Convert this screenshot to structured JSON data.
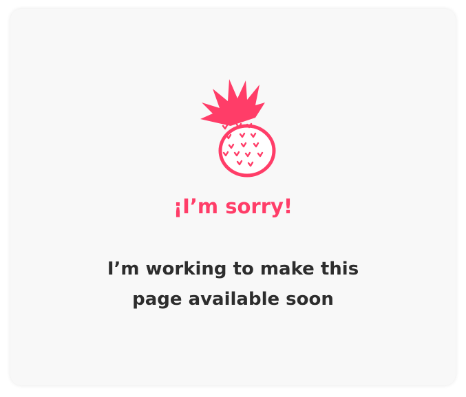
{
  "colors": {
    "accent": "#ff3d68",
    "text": "#2d2d2d",
    "card_background": "#f8f8f8"
  },
  "illustration": {
    "icon": "pineapple-icon"
  },
  "title": "¡I’m sorry!",
  "message": {
    "line1": "I’m working to make this",
    "line2": "page available soon"
  }
}
